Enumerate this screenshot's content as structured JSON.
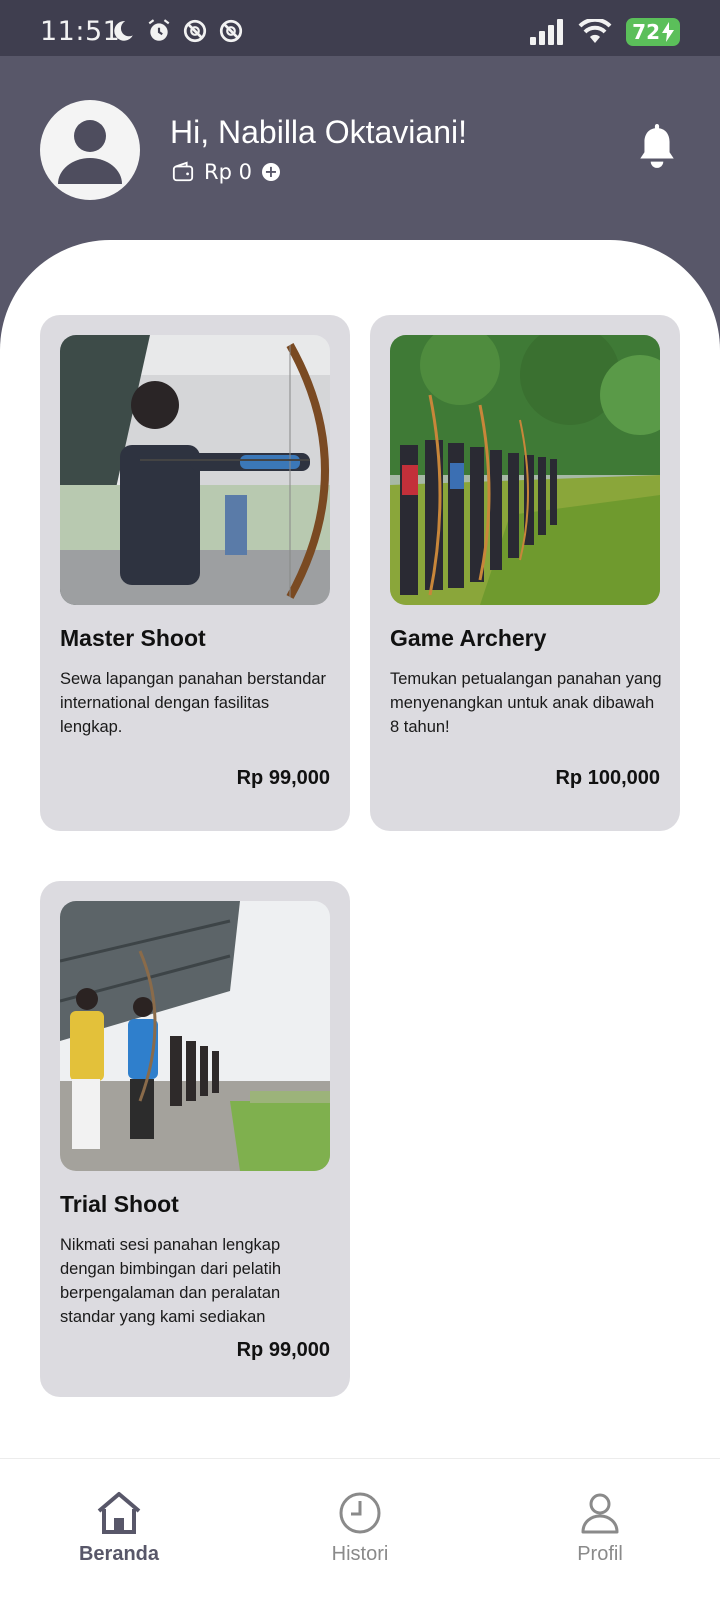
{
  "status_bar": {
    "time": "11:51",
    "battery": "72",
    "left_icons": [
      "moon-icon",
      "alarm-icon",
      "location-off-icon",
      "location-off-icon"
    ],
    "right_icons": [
      "signal-icon",
      "wifi-icon",
      "battery-icon"
    ]
  },
  "header": {
    "greeting": "Hi, Nabilla Oktaviani!",
    "wallet_balance": "Rp 0",
    "bell_icon": "bell-icon",
    "avatar_icon": "user-icon",
    "wallet_icon": "wallet-icon",
    "add_icon": "plus-circle-icon"
  },
  "cards": [
    {
      "title": "Master Shoot",
      "description": "Sewa lapangan panahan berstandar international dengan fasilitas lengkap.",
      "price": "Rp 99,000"
    },
    {
      "title": "Game Archery",
      "description": "Temukan petualangan panahan yang menyenangkan untuk anak dibawah 8 tahun!",
      "price": "Rp 100,000"
    },
    {
      "title": "Trial Shoot",
      "description": "Nikmati sesi panahan  lengkap dengan bimbingan dari pelatih berpengalaman dan peralatan standar yang kami sediakan",
      "price": "Rp 99,000"
    }
  ],
  "bottom_nav": {
    "items": [
      {
        "label": "Beranda",
        "icon": "home-icon",
        "active": true
      },
      {
        "label": "Histori",
        "icon": "clock-icon",
        "active": false
      },
      {
        "label": "Profil",
        "icon": "person-icon",
        "active": false
      }
    ]
  },
  "colors": {
    "header_bg": "#585769",
    "status_bg": "#3f3e4f",
    "card_bg": "#dcdbe0",
    "active_nav": "#585769",
    "battery": "#5bbf5a"
  }
}
